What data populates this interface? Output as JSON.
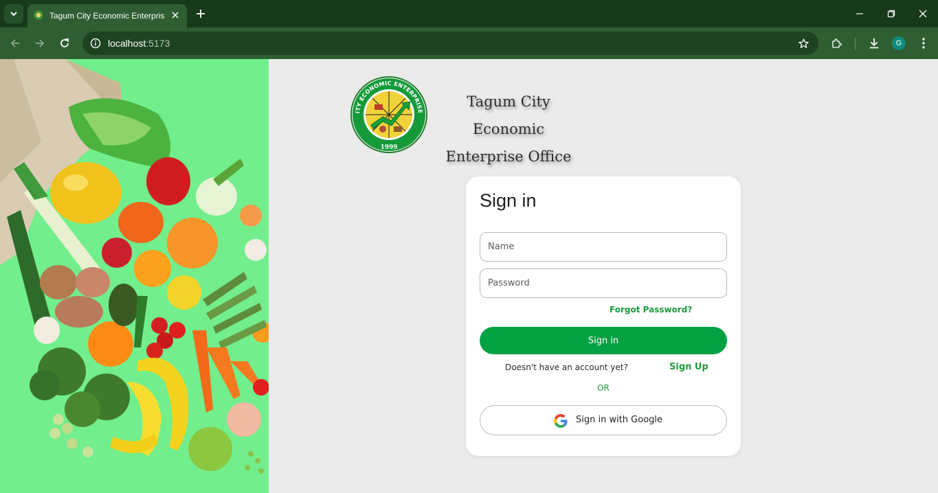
{
  "browser": {
    "tab_title": "Tagum City Economic Enterprise Office",
    "url_host": "localhost",
    "url_port": ":5173",
    "profile_initial": "G",
    "theme_color": "#2e5e31"
  },
  "org": {
    "logo_text_top": "TAGUM CITY ECONOMIC ENTERPRISES OFFICE",
    "logo_year": "1999",
    "title_line1": "Tagum City Economic",
    "title_line2": "Enterprise Office"
  },
  "signin": {
    "heading": "Sign in",
    "name_placeholder": "Name",
    "password_placeholder": "Password",
    "forgot_label": "Forgot Password?",
    "submit_label": "Sign in",
    "no_account_text": "Doesn't have an account yet?",
    "signup_label": "Sign Up",
    "or_text": "OR",
    "google_label": "Sign in with Google"
  },
  "colors": {
    "accent_green": "#02a243",
    "link_green": "#1e9a3e",
    "hero_background": "#72ee8c",
    "page_background": "#ebebeb"
  }
}
